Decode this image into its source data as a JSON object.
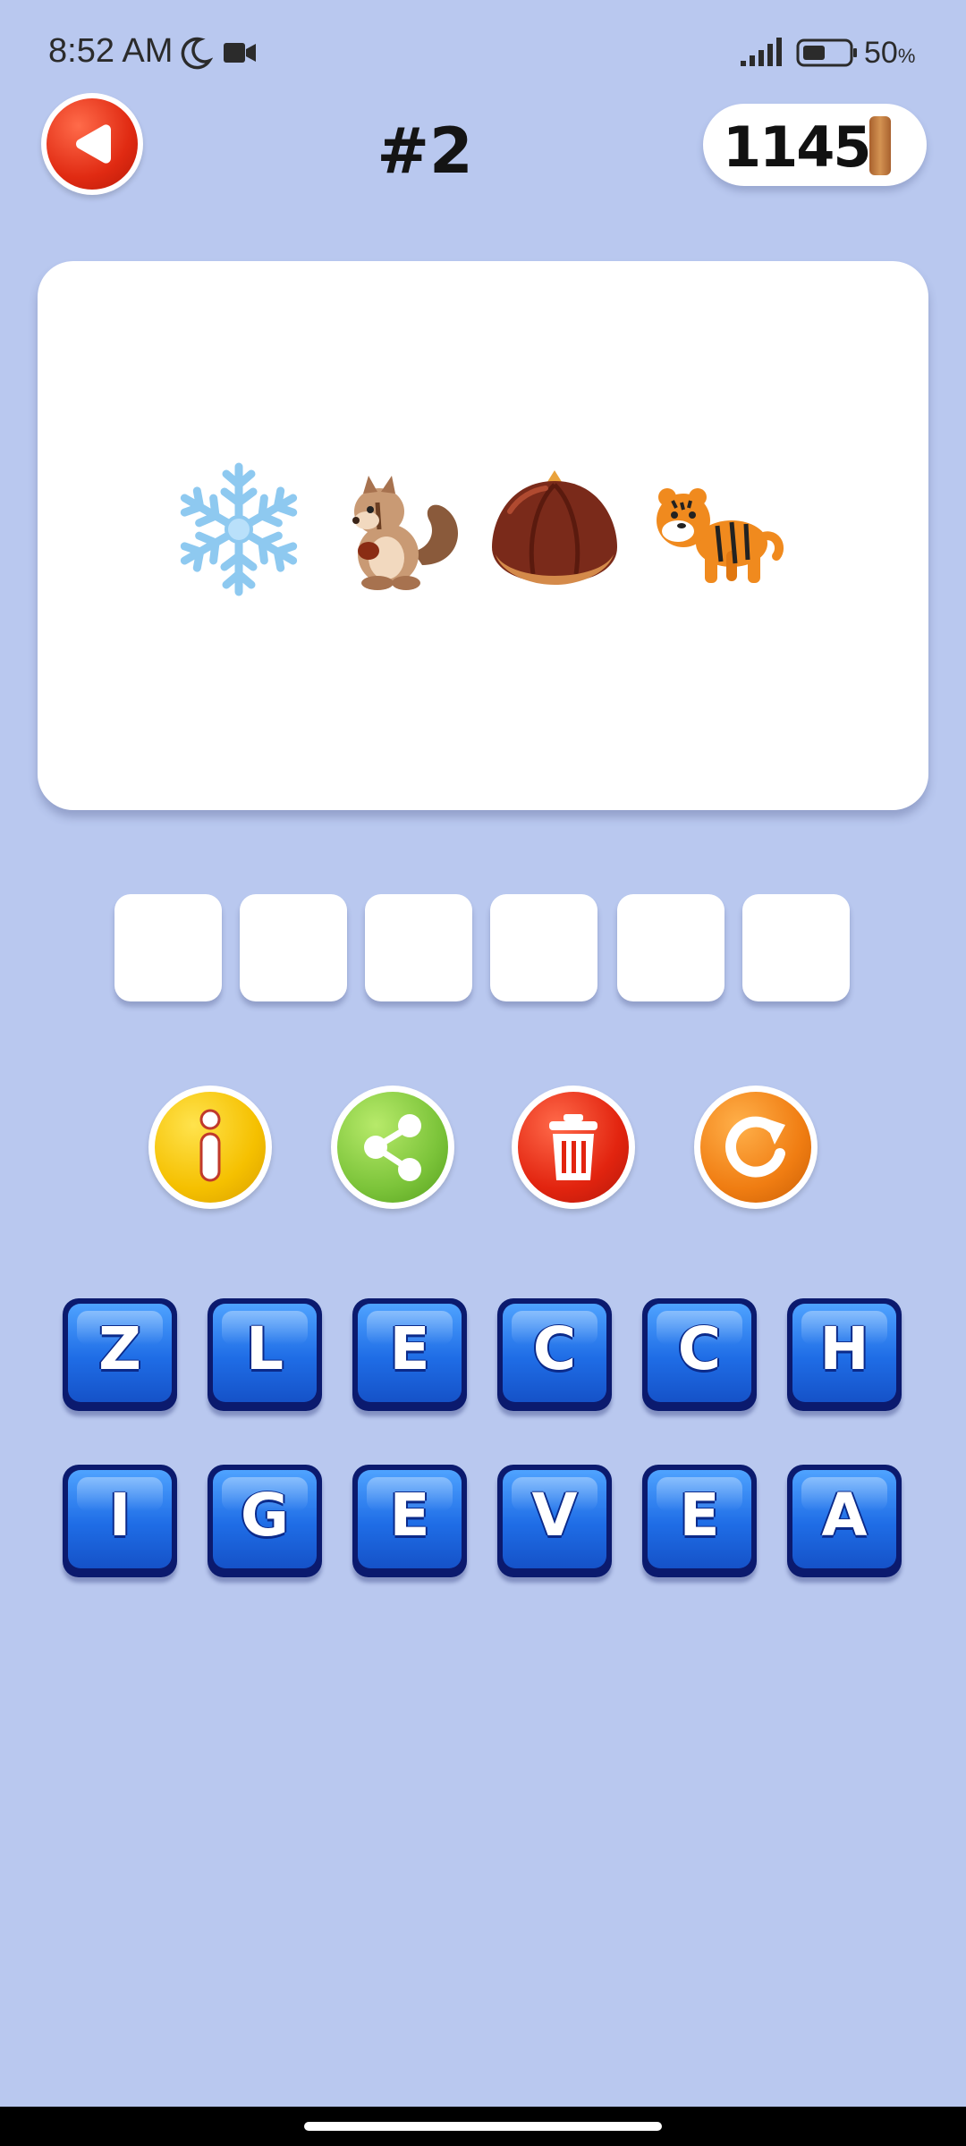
{
  "status_bar": {
    "time": "8:52 AM",
    "battery_percent": "50",
    "battery_symbol": "%",
    "icons": [
      "moon-icon",
      "video-camera-icon",
      "signal-icon",
      "battery-icon"
    ]
  },
  "header": {
    "level": "#2",
    "coins": "1145",
    "back_icon": "back-arrow-icon",
    "coin_icon": "coin-icon"
  },
  "puzzle": {
    "emojis": [
      "snowflake",
      "chipmunk",
      "chestnut",
      "tiger"
    ]
  },
  "answer_slots": [
    "",
    "",
    "",
    "",
    "",
    ""
  ],
  "actions": [
    {
      "name": "info",
      "icon": "info-icon",
      "color": "#f5c000"
    },
    {
      "name": "share",
      "icon": "share-icon",
      "color": "#7cc43a"
    },
    {
      "name": "delete",
      "icon": "trash-icon",
      "color": "#e2240f"
    },
    {
      "name": "restart",
      "icon": "refresh-icon",
      "color": "#f07d12"
    }
  ],
  "keyboard": {
    "row1": [
      "Z",
      "L",
      "E",
      "C",
      "C",
      "H"
    ],
    "row2": [
      "I",
      "G",
      "E",
      "V",
      "E",
      "A"
    ]
  },
  "colors": {
    "background": "#b9c8ef",
    "key_blue": "#1f6de6",
    "back_red": "#e02a12"
  }
}
